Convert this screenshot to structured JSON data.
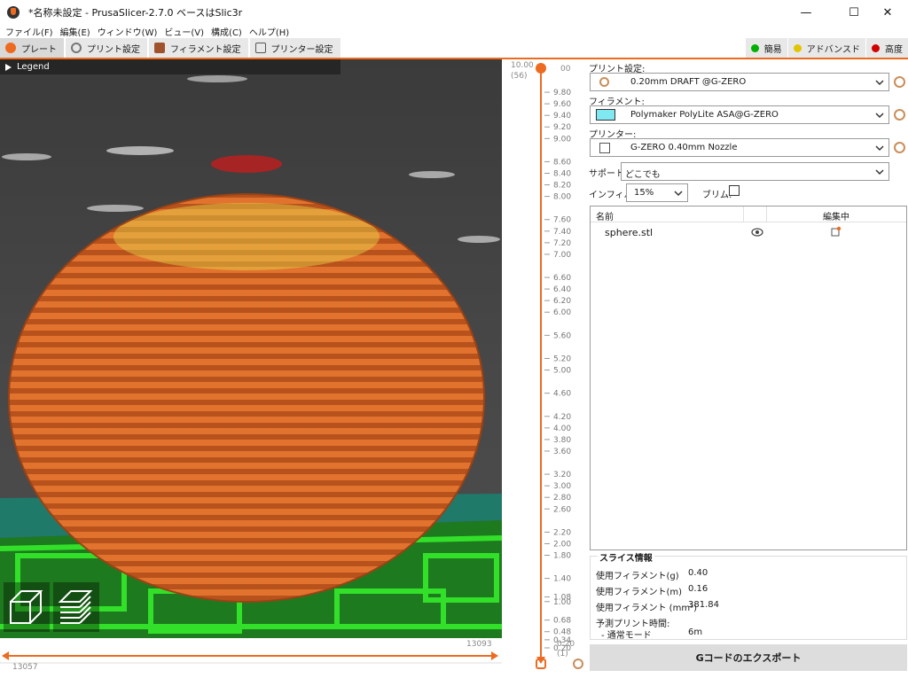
{
  "window": {
    "title": "*名称未設定 - PrusaSlicer-2.7.0 ベースはSlic3r",
    "minimize": "—",
    "maximize": "☐",
    "close": "✕"
  },
  "menu": [
    "ファイル(F)",
    "編集(E)",
    "ウィンドウ(W)",
    "ビュー(V)",
    "構成(C)",
    "ヘルプ(H)"
  ],
  "tabs": [
    {
      "label": "プレート",
      "icon": "plater-icon"
    },
    {
      "label": "プリント設定",
      "icon": "print-settings-icon"
    },
    {
      "label": "フィラメント設定",
      "icon": "filament-settings-icon"
    },
    {
      "label": "プリンター設定",
      "icon": "printer-settings-icon"
    }
  ],
  "modes": [
    {
      "label": "簡易",
      "color": "#00b000"
    },
    {
      "label": "アドバンスド",
      "color": "#e3c400"
    },
    {
      "label": "高度",
      "color": "#d00000"
    }
  ],
  "legend": {
    "label": "Legend"
  },
  "layer_slider": {
    "top_value": "10.00",
    "top_layer": "(56)",
    "bottom_value": "0.20",
    "bottom_layer": "(1)",
    "ticks": [
      "9.80",
      "9.60",
      "9.40",
      "9.20",
      "9.00",
      "8.60",
      "8.40",
      "8.20",
      "8.00",
      "7.60",
      "7.40",
      "7.20",
      "7.00",
      "6.60",
      "6.40",
      "6.20",
      "6.00",
      "5.60",
      "5.20",
      "5.00",
      "4.60",
      "4.20",
      "4.00",
      "3.80",
      "3.60",
      "3.20",
      "3.00",
      "2.80",
      "2.60",
      "2.20",
      "2.00",
      "1.80",
      "1.40",
      "1.08",
      "1.00",
      "0.68",
      "0.48",
      "0.34",
      "0.20"
    ],
    "top_value_right": "00"
  },
  "move_slider": {
    "right_value": "13093",
    "left_value": "13057"
  },
  "print_settings": {
    "label": "プリント設定:",
    "value": "0.20mm DRAFT @G-ZERO"
  },
  "filament": {
    "label": "フィラメント:",
    "value": "Polymaker PolyLite ASA@G-ZERO",
    "color": "#7fe8f0"
  },
  "printer": {
    "label": "プリンター:",
    "value": "G-ZERO 0.40mm Nozzle"
  },
  "support": {
    "label": "サポート:",
    "value": "どこでも"
  },
  "infill": {
    "label": "インフィル:",
    "value": "15%"
  },
  "brim": {
    "label": "ブリム:"
  },
  "object_list": {
    "col_name": "名前",
    "col_editing": "編集中",
    "items": [
      {
        "name": "sphere.stl"
      }
    ]
  },
  "slice_info": {
    "title": "スライス情報",
    "rows": [
      {
        "label": "使用フィラメント(g)",
        "value": "0.40"
      },
      {
        "label": "使用フィラメント(m)",
        "value": "0.16"
      },
      {
        "label": "使用フィラメント (mm³)",
        "value": "381.84"
      },
      {
        "label": "予測プリント時間:",
        "value": ""
      },
      {
        "label": "- 通常モード",
        "value": "6m"
      }
    ]
  },
  "export_button": {
    "label": "Gコードのエクスポート"
  }
}
